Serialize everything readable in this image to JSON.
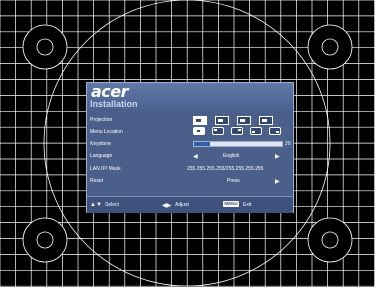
{
  "osd": {
    "brand": "acer",
    "title": "Installation",
    "rows": {
      "projection": {
        "label": "Projection"
      },
      "menu_location": {
        "label": "Menu Location"
      },
      "keystone": {
        "label": "Keystone",
        "value": "20",
        "level": 0.18
      },
      "language": {
        "label": "Language",
        "value": "English"
      },
      "lan_ip_mask": {
        "label": "LAN IP/ Mask",
        "value": "255.255.255.255/255.255.255.255"
      },
      "reset": {
        "label": "Reset",
        "value": "Press"
      }
    },
    "footer": {
      "select": "Select",
      "adjust": "Adjust",
      "menu_key": "MENU",
      "exit": "Exit"
    }
  },
  "colors": {
    "background": "#000000",
    "grid": "#ffffff",
    "panel": "#4a5f8a",
    "footer": "#3f527d",
    "keystone_fill": "#2f5ea8"
  }
}
